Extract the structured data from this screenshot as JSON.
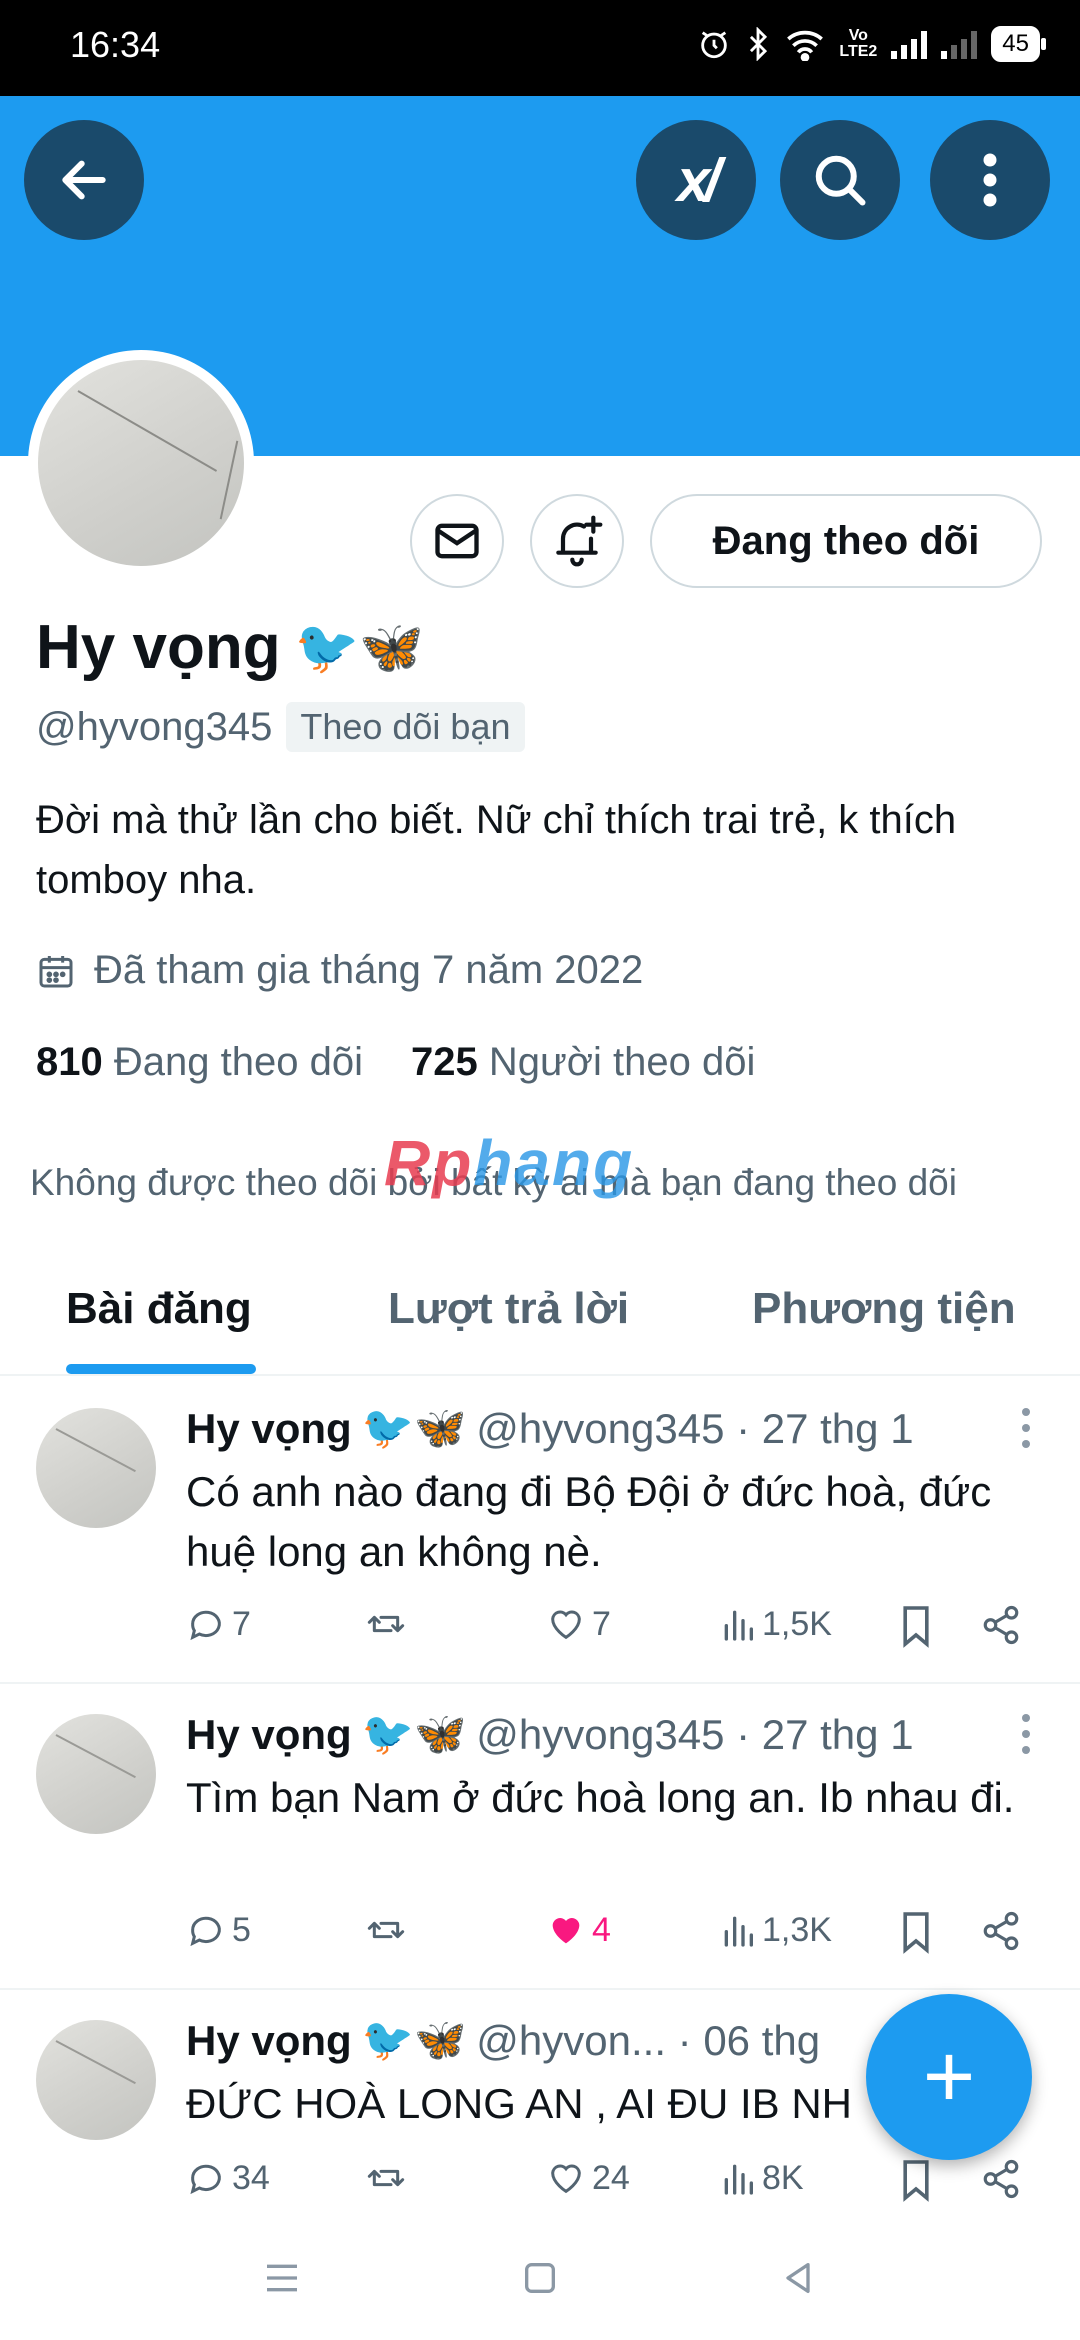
{
  "status_bar": {
    "time": "16:34",
    "battery": "45",
    "lte_label": "Vo\nLTE2",
    "icons": [
      "alarm-icon",
      "bluetooth-icon",
      "wifi-icon",
      "volte-icon",
      "signal-icon",
      "signal-icon",
      "battery-icon"
    ]
  },
  "header": {
    "accent_color": "#1d9bf0",
    "grok_label": "x/"
  },
  "profile": {
    "name": "Hy vọng",
    "name_emoji": "🐦🦋",
    "handle": "@hyvong345",
    "follows_you": "Theo dõi bạn",
    "follow_button": "Đang theo dõi",
    "bio": "Đời mà thử lần cho biết. Nữ chỉ thích trai trẻ, k thích tomboy nha.",
    "joined": "Đã tham gia tháng 7 năm 2022",
    "following_count": "810",
    "following_label": "Đang theo dõi",
    "followers_count": "725",
    "followers_label": "Người theo dõi",
    "not_followed_note": "Không được theo dõi bởi bất kỳ ai mà bạn đang theo dõi"
  },
  "watermark": {
    "part1": "Rp",
    "part2": "hang"
  },
  "tabs": [
    {
      "label": "Bài đăng",
      "active": true
    },
    {
      "label": "Lượt trả lời",
      "active": false
    },
    {
      "label": "Phương tiện",
      "active": false
    }
  ],
  "posts": [
    {
      "name": "Hy vọng",
      "emoji": "🐦🦋",
      "meta": "@hyvong345 · 27 thg 1",
      "text": "Có anh nào đang đi Bộ Đội ở đức hoà, đức huệ long an không nè.",
      "replies": "7",
      "likes": "7",
      "views": "1,5K",
      "liked": false
    },
    {
      "name": "Hy vọng",
      "emoji": "🐦🦋",
      "meta": "@hyvong345 · 27 thg 1",
      "text": "Tìm bạn Nam ở đức hoà long an. Ib nhau đi.",
      "replies": "5",
      "likes": "4",
      "views": "1,3K",
      "liked": true
    },
    {
      "name": "Hy vọng",
      "emoji": "🐦🦋",
      "meta": "@hyvon...  · 06 thg",
      "text": "ĐỨC HOÀ LONG AN , AI ĐU IB NH",
      "replies": "34",
      "likes": "24",
      "views": "8K",
      "liked": false
    }
  ],
  "fab": {
    "label": "+"
  }
}
